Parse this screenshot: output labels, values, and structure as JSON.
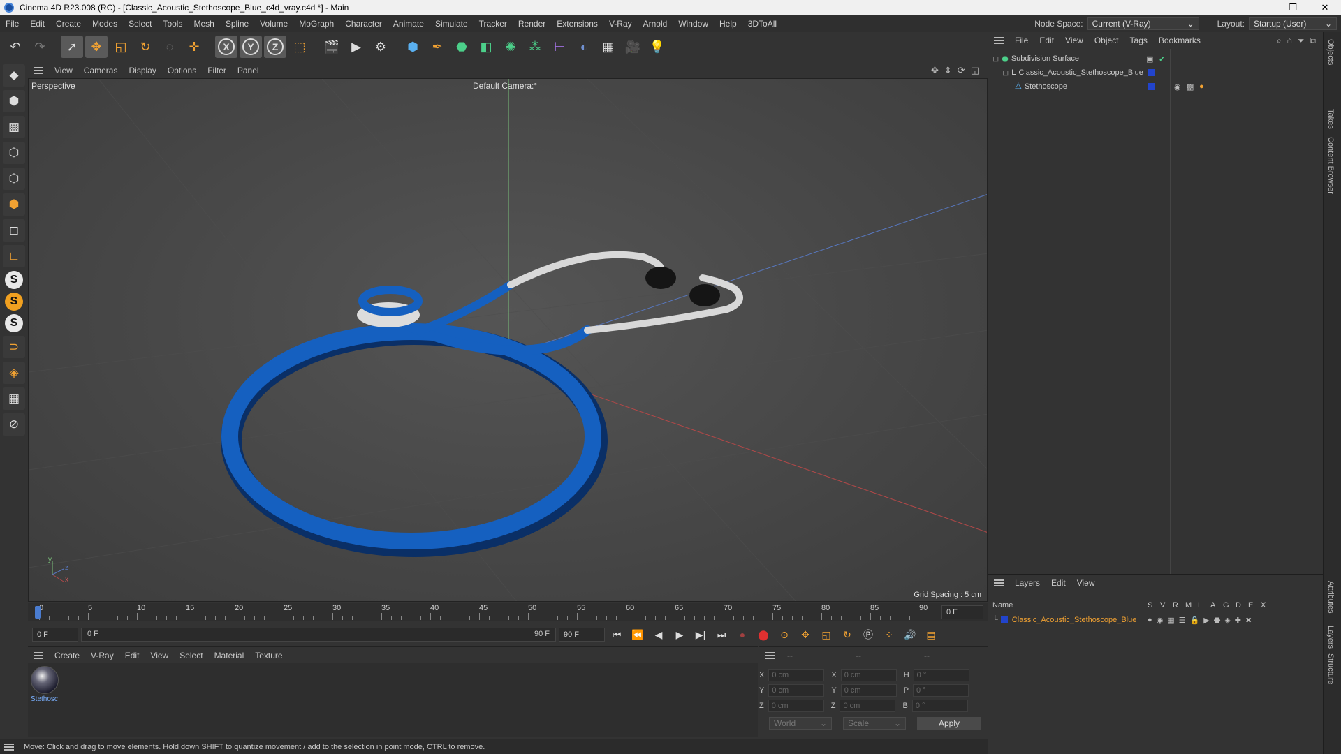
{
  "window": {
    "title": "Cinema 4D R23.008 (RC) - [Classic_Acoustic_Stethoscope_Blue_c4d_vray.c4d *] - Main",
    "minimize": "–",
    "maximize": "❐",
    "close": "✕"
  },
  "menubar": {
    "items": [
      "File",
      "Edit",
      "Create",
      "Modes",
      "Select",
      "Tools",
      "Mesh",
      "Spline",
      "Volume",
      "MoGraph",
      "Character",
      "Animate",
      "Simulate",
      "Tracker",
      "Render",
      "Extensions",
      "V-Ray",
      "Arnold",
      "Window",
      "Help",
      "3DToAll"
    ],
    "node_space_label": "Node Space:",
    "node_space_value": "Current (V-Ray)",
    "layout_label": "Layout:",
    "layout_value": "Startup (User)"
  },
  "toolbar": {
    "icons": [
      "undo-icon",
      "redo-icon",
      "select-icon",
      "move-icon",
      "scale-icon",
      "rotate-icon",
      "lasso-icon",
      "add-icon",
      "x-axis-icon",
      "y-axis-icon",
      "z-axis-icon",
      "coord-system-icon",
      "render-region-icon",
      "render-view-icon",
      "render-settings-icon",
      "cube-icon",
      "pen-icon",
      "subdivision-icon",
      "extrude-icon",
      "cloner-icon",
      "mograph-icon",
      "deformer-icon",
      "field-icon",
      "floor-icon",
      "camera-icon",
      "light-icon"
    ],
    "x_label": "X",
    "y_label": "Y",
    "z_label": "Z"
  },
  "left_tools": {
    "s_label": "S"
  },
  "viewport": {
    "menu": [
      "View",
      "Cameras",
      "Display",
      "Options",
      "Filter",
      "Panel"
    ],
    "projection": "Perspective",
    "camera": "Default Camera",
    "camera_suffix": ":°",
    "grid_spacing": "Grid Spacing : 5 cm",
    "axis_y": "y",
    "axis_z": "z",
    "axis_x": "x",
    "colors": {
      "tube": "#1560c0",
      "tube_dark": "#0b3d85",
      "ear": "#e0e0e0",
      "tip": "#151515"
    }
  },
  "timeline": {
    "ticks": [
      "0",
      "5",
      "10",
      "15",
      "20",
      "25",
      "30",
      "35",
      "40",
      "45",
      "50",
      "55",
      "60",
      "65",
      "70",
      "75",
      "80",
      "85",
      "90"
    ],
    "current_frame": "0 F"
  },
  "transport": {
    "start": "0 F",
    "range_start": "0 F",
    "range_end": "90 F",
    "end": "90 F"
  },
  "material_manager": {
    "menu": [
      "Create",
      "V-Ray",
      "Edit",
      "View",
      "Select",
      "Material",
      "Texture"
    ],
    "material_name": "Stethosc"
  },
  "coordinates": {
    "header": [
      "--",
      "--",
      "--"
    ],
    "rows": [
      {
        "a": "X",
        "av": "0 cm",
        "b": "X",
        "bv": "0 cm",
        "c": "H",
        "cv": "0 °"
      },
      {
        "a": "Y",
        "av": "0 cm",
        "b": "Y",
        "bv": "0 cm",
        "c": "P",
        "cv": "0 °"
      },
      {
        "a": "Z",
        "av": "0 cm",
        "b": "Z",
        "bv": "0 cm",
        "c": "B",
        "cv": "0 °"
      }
    ],
    "space": "World",
    "mode": "Scale",
    "apply": "Apply"
  },
  "status": {
    "text": "Move: Click and drag to move elements. Hold down SHIFT to quantize movement / add to the selection in point mode, CTRL to remove."
  },
  "object_manager": {
    "menu": [
      "File",
      "Edit",
      "View",
      "Object",
      "Tags",
      "Bookmarks"
    ],
    "objects": [
      {
        "name": "Subdivision Surface",
        "indent": 0
      },
      {
        "name": "Classic_Acoustic_Stethoscope_Blue",
        "indent": 1
      },
      {
        "name": "Stethoscope",
        "indent": 2
      }
    ]
  },
  "layer_manager": {
    "menu": [
      "Layers",
      "Edit",
      "View"
    ],
    "columns": [
      "Name",
      "S",
      "V",
      "R",
      "M",
      "L",
      "A",
      "G",
      "D",
      "E",
      "X"
    ],
    "layers": [
      {
        "name": "Classic_Acoustic_Stethoscope_Blue",
        "color": "#2244cc"
      }
    ]
  },
  "side_tabs": [
    "Objects",
    "Takes",
    "Content Browser",
    "Attributes",
    "Layers",
    "Structure"
  ]
}
